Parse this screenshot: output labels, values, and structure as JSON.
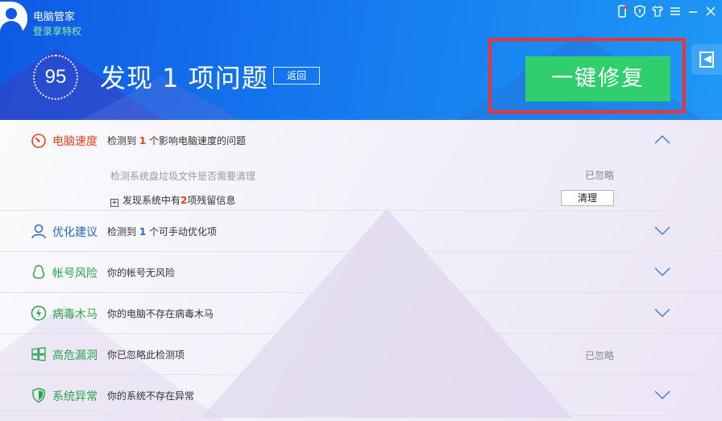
{
  "header": {
    "app_title": "电脑管家",
    "login_link": "登录享特权",
    "score": "95",
    "headline": "发现 1 项问题",
    "back_label": "返回",
    "fix_label": "一键修复"
  },
  "titlebar": {
    "icons": [
      "phone-icon",
      "shield-icon",
      "skin-icon",
      "menu-icon",
      "minimize-icon",
      "close-icon"
    ]
  },
  "rows": [
    {
      "id": "speed",
      "name": "电脑速度",
      "name_color": "#e0421f",
      "desc_pre": "检测到 ",
      "desc_num": "1",
      "desc_post": " 个影响电脑速度的问题",
      "expanded": true,
      "sub": {
        "item1": "检测系统盘垃圾文件是否需要清理",
        "item1_status": "已忽略",
        "item2_pre": "发现系统中有",
        "item2_num": "2",
        "item2_post": "项残留信息",
        "clean_label": "清理"
      }
    },
    {
      "id": "optimize",
      "name": "优化建议",
      "name_color": "#2a66c8",
      "desc_pre": "检测到 ",
      "desc_num": "1",
      "desc_post": " 个可手动优化项"
    },
    {
      "id": "account",
      "name": "帐号风险",
      "name_color": "#2aa44a",
      "desc": "你的帐号无风险"
    },
    {
      "id": "virus",
      "name": "病毒木马",
      "name_color": "#2aa44a",
      "desc": "你的电脑不存在病毒木马"
    },
    {
      "id": "vuln",
      "name": "高危漏洞",
      "name_color": "#2aa44a",
      "desc": "你已忽略此检测项",
      "status": "已忽略"
    },
    {
      "id": "system",
      "name": "系统异常",
      "name_color": "#2aa44a",
      "desc": "你的系统不存在异常"
    }
  ],
  "colors": {
    "header_blue": "#1578ee",
    "fix_green": "#2fcf6d",
    "highlight_red": "#ee3333",
    "warn_orange": "#e0421f",
    "safe_green": "#2aa44a",
    "info_blue": "#2a66c8"
  }
}
